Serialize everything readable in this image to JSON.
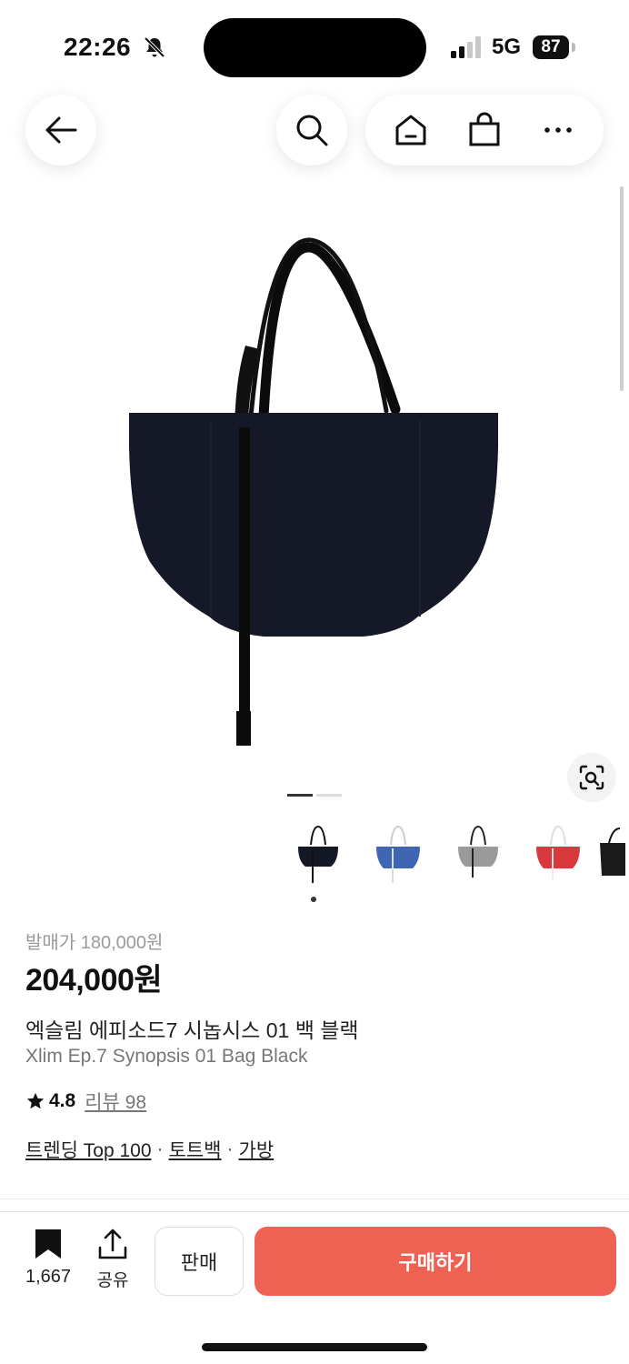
{
  "status_bar": {
    "time": "22:26",
    "network": "5G",
    "battery": "87"
  },
  "nav": {
    "icons": [
      "back-arrow-icon",
      "search-icon",
      "home-icon",
      "shopping-bag-icon",
      "more-icon"
    ]
  },
  "gallery": {
    "pages": 2,
    "current_page": 1,
    "thumbnails": [
      {
        "color": "black",
        "bag_color": "#141824"
      },
      {
        "color": "blue",
        "bag_color": "#3f66b2"
      },
      {
        "color": "gray",
        "bag_color": "#9a9a9a"
      },
      {
        "color": "red",
        "bag_color": "#d9383c"
      },
      {
        "color": "black-partial",
        "bag_color": "#1a1a1a"
      }
    ]
  },
  "product": {
    "release_price": "발매가 180,000원",
    "price": "204,000원",
    "name_ko": "엑슬림 에피소드7 시놉시스 01 백 블랙",
    "name_en": "Xlim Ep.7 Synopsis 01 Bag Black",
    "rating": "4.8",
    "review": "리뷰 98",
    "tags": [
      "트렌딩 Top 100",
      "토트백",
      "가방"
    ],
    "tag_separator": "·"
  },
  "bottom_bar": {
    "bookmark_count": "1,667",
    "share_label": "공유",
    "sell_label": "판매",
    "buy_label": "구매하기"
  },
  "colors": {
    "accent": "#ef6253",
    "bag": "#151826"
  }
}
